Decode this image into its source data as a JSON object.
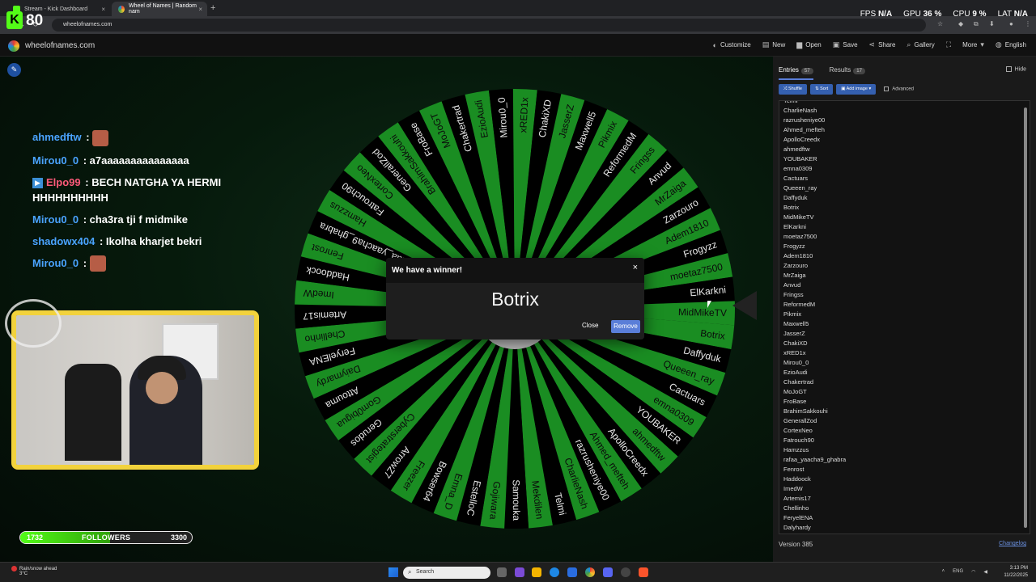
{
  "browser": {
    "tabs": [
      {
        "title": "Stream - Kick Dashboard",
        "active": false
      },
      {
        "title": "Wheel of Names | Random nam",
        "active": true
      }
    ],
    "url": "wheelofnames.com"
  },
  "overlay": {
    "viewers": "80",
    "stats": {
      "fps_label": "FPS",
      "fps": "N/A",
      "gpu_label": "GPU",
      "gpu": "36 %",
      "cpu_label": "CPU",
      "cpu": "9 %",
      "lat_label": "LAT",
      "lat": "N/A"
    },
    "followers": {
      "current": "1732",
      "label": "FOLLOWERS",
      "goal": "3300",
      "progress": 0.525
    }
  },
  "site": {
    "name": "wheelofnames.com",
    "menu": [
      "Customize",
      "New",
      "Open",
      "Save",
      "Share",
      "Gallery",
      "More",
      "English"
    ]
  },
  "chat": [
    {
      "user": "ahmedftw",
      "color": "#4aa3ff",
      "text": "",
      "emote": true
    },
    {
      "user": "Mirou0_0",
      "color": "#4aa3ff",
      "text": "a7aaaaaaaaaaaaaaa",
      "emote": false
    },
    {
      "user": "Elpo99",
      "color": "#ff5a7a",
      "text": "BECH NATGHA YA HERMI HHHHHHHHHH",
      "emote": false,
      "badge": true
    },
    {
      "user": "Mirou0_0",
      "color": "#4aa3ff",
      "text": "cha3ra tji f midmike",
      "emote": false
    },
    {
      "user": "shadowx404",
      "color": "#4aa3ff",
      "text": "Ikolha kharjet bekri",
      "emote": false
    },
    {
      "user": "Mirou0_0",
      "color": "#4aa3ff",
      "text": "",
      "emote": true
    }
  ],
  "wheel": {
    "names": [
      "Botrix",
      "Daffyduk",
      "Queeen_ray",
      "Cactuars",
      "emna0309",
      "YOUBAKER",
      "ahmedftw",
      "ApolloCreedx",
      "Ahmed_mefteh",
      "razrusheniye00",
      "CharlieNash",
      "Telmi",
      "Mekdilen",
      "Samouka",
      "Gojiwara",
      "EstelloC",
      "Emna_D",
      "Bowser64",
      "Freezer",
      "ArrowZ7",
      "Cyberstrategist",
      "Gerudos",
      "Gom0bigua",
      "Attouma",
      "Daiymardy",
      "FeryelENA",
      "Chellinho",
      "Artemis17",
      "ImedW",
      "Haddoock",
      "Fenrost",
      "rafaa_yaacha9_ghabra",
      "Hamzzus",
      "Fatrouch90",
      "CortexNeo",
      "GenerallZod",
      "BrahimSakkouhi",
      "FroBase",
      "MoJoGT",
      "Chakertrad",
      "EzioAudi",
      "Mirou0_0",
      "xRED1x",
      "ChakiXD",
      "JasserZ",
      "Maxwell5",
      "Pikmix",
      "ReformedM",
      "Fringss",
      "Anvud",
      "MrZaiga",
      "Zarzouro",
      "Adem1810",
      "Frogyzz",
      "moetaz7500",
      "ElKarkni",
      "MidMikeTV"
    ],
    "colors": [
      "#1a8d22",
      "#000000"
    ]
  },
  "modal": {
    "title": "We have a winner!",
    "winner": "Botrix",
    "close_label": "Close",
    "remove_label": "Remove",
    "close_icon": "×"
  },
  "panel": {
    "tab_entries": "Entries",
    "entries_count": "57",
    "tab_results": "Results",
    "results_count": "17",
    "hide_label": "Hide",
    "shuffle_label": "Shuffle",
    "sort_label": "Sort",
    "add_image_label": "Add image",
    "advanced_label": "Advanced",
    "entries": [
      "Telmi",
      "CharlieNash",
      "razrusheniye00",
      "Ahmed_mefteh",
      "ApolloCreedx",
      "ahmedftw",
      "YOUBAKER",
      "emna0309",
      "Cactuars",
      "Queeen_ray",
      "Daffyduk",
      "Botrix",
      "MidMikeTV",
      "ElKarkni",
      "moetaz7500",
      "Frogyzz",
      "Adem1810",
      "Zarzouro",
      "MrZaiga",
      "Anvud",
      "Fringss",
      "ReformedM",
      "Pikmix",
      "Maxwell5",
      "JasserZ",
      "ChakiXD",
      "xRED1x",
      "Mirou0_0",
      "EzioAudi",
      "Chakertrad",
      "MoJoGT",
      "FroBase",
      "BrahimSakkouhi",
      "GenerallZod",
      "CortexNeo",
      "Fatrouch90",
      "Hamzzus",
      "rafaa_yaacha9_ghabra",
      "Fenrost",
      "Haddoock",
      "ImedW",
      "Artemis17",
      "Chellinho",
      "FeryelENA",
      "Dalyhardy"
    ],
    "version": "Version 385",
    "changelog": "Changelog"
  },
  "taskbar": {
    "weather_title": "Rain/snow ahead",
    "weather_temp": "3°C",
    "search_placeholder": "Search",
    "lang": "ENG",
    "time": "3:13 PM",
    "date": "11/22/2025"
  }
}
